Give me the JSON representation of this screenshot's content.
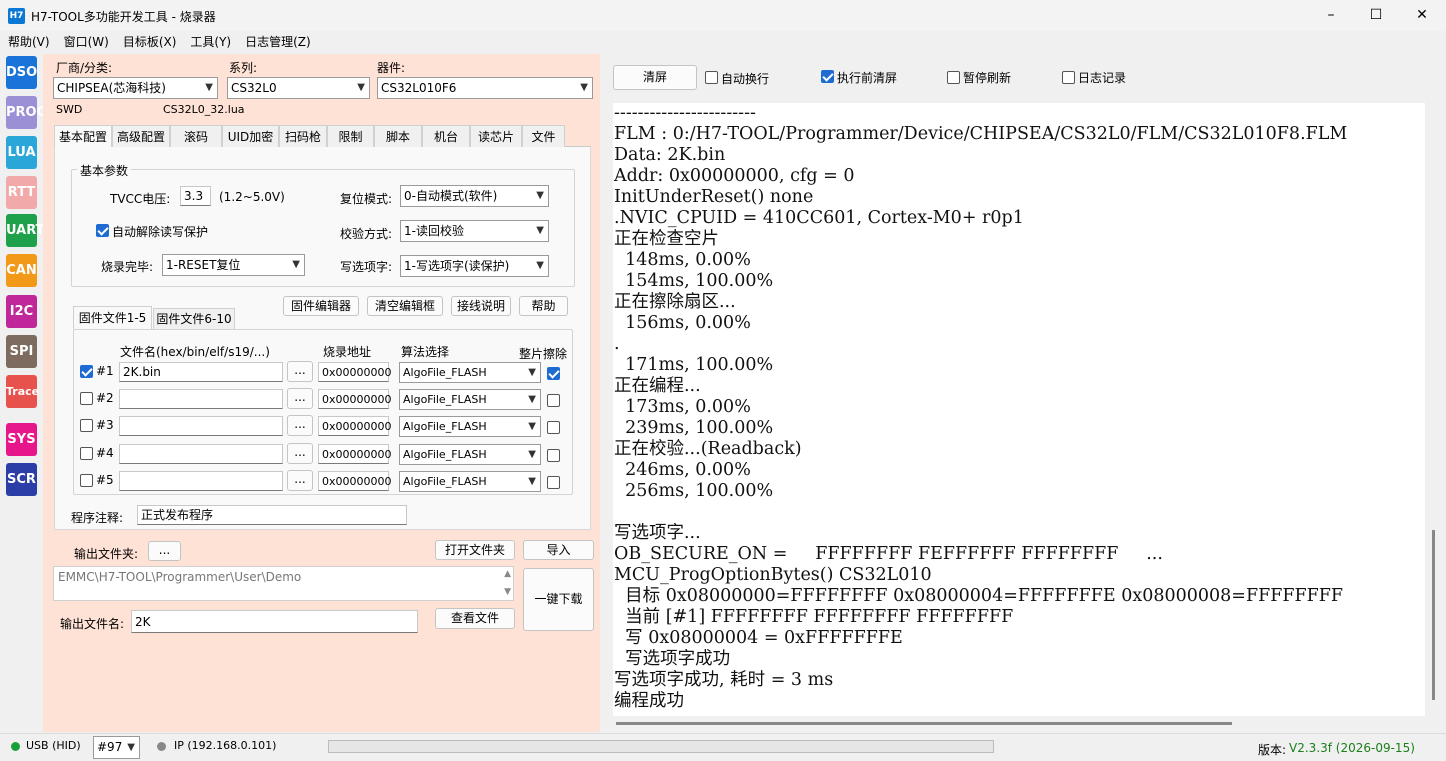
{
  "window": {
    "icon": "H7",
    "title": "H7-TOOL多功能开发工具 - 烧录器",
    "minimize_icon": "–",
    "maximize_icon": "☐",
    "close_icon": "✕"
  },
  "menu": [
    "帮助(V)",
    "窗口(W)",
    "目标板(X)",
    "工具(Y)",
    "日志管理(Z)"
  ],
  "sidebar": [
    {
      "label": "DSO",
      "color": "#1a73d9"
    },
    {
      "label": "PROG",
      "color": "#9b8fd6"
    },
    {
      "label": "LUA",
      "color": "#2aa6d8"
    },
    {
      "label": "RTT",
      "color": "#f2a9a9"
    },
    {
      "label": "UART",
      "color": "#1fa14b"
    },
    {
      "label": "CAN",
      "color": "#f29a18"
    },
    {
      "label": "I2C",
      "color": "#c0289a"
    },
    {
      "label": "SPI",
      "color": "#7d6b5f"
    },
    {
      "label": "Trace",
      "color": "#e8524c"
    },
    {
      "label": "SYS",
      "color": "#e6178a"
    },
    {
      "label": "SCR",
      "color": "#2b3ea8"
    }
  ],
  "device": {
    "vendor_label": "厂商/分类:",
    "vendor_value": "CHIPSEA(芯海科技)",
    "series_label": "系列:",
    "series_value": "CS32L0",
    "part_label": "器件:",
    "part_value": "CS32L010F6",
    "interface": "SWD",
    "lua_file": "CS32L0_32.lua"
  },
  "tabs": [
    "基本配置",
    "高级配置",
    "滚码",
    "UID加密",
    "扫码枪",
    "限制",
    "脚本",
    "机台",
    "读芯片",
    "文件"
  ],
  "basic": {
    "group_title": "基本参数",
    "tvcc_label": "TVCC电压:",
    "tvcc_value": "3.3",
    "tvcc_range": "(1.2~5.0V)",
    "auto_unprotect_label": "自动解除读写保护",
    "finish_label": "烧录完毕:",
    "finish_value": "1-RESET复位",
    "reset_label": "复位模式:",
    "reset_value": "0-自动模式(软件)",
    "verify_label": "校验方式:",
    "verify_value": "1-读回校验",
    "option_label": "写选项字:",
    "option_value": "1-写选项字(读保护)"
  },
  "fw": {
    "tab1": "固件文件1-5",
    "tab2": "固件文件6-10",
    "btn_editor": "固件编辑器",
    "btn_clear_editor": "清空编辑框",
    "btn_wiring": "接线说明",
    "btn_help": "帮助",
    "col_file": "文件名(hex/bin/elf/s19/...)",
    "col_addr": "烧录地址",
    "col_algo": "算法选择",
    "col_erase": "整片擦除",
    "browse": "...",
    "rows": [
      {
        "id": "#1",
        "checked": true,
        "file": "2K.bin",
        "addr": "0x00000000",
        "algo": "AlgoFile_FLASH",
        "erase": true
      },
      {
        "id": "#2",
        "checked": false,
        "file": "",
        "addr": "0x00000000",
        "algo": "AlgoFile_FLASH",
        "erase": false
      },
      {
        "id": "#3",
        "checked": false,
        "file": "",
        "addr": "0x00000000",
        "algo": "AlgoFile_FLASH",
        "erase": false
      },
      {
        "id": "#4",
        "checked": false,
        "file": "",
        "addr": "0x00000000",
        "algo": "AlgoFile_FLASH",
        "erase": false
      },
      {
        "id": "#5",
        "checked": false,
        "file": "",
        "addr": "0x00000000",
        "algo": "AlgoFile_FLASH",
        "erase": false
      }
    ],
    "note_label": "程序注释:",
    "note_value": "正式发布程序"
  },
  "output": {
    "folder_label": "输出文件夹:",
    "folder_browse": "...",
    "open_folder": "打开文件夹",
    "import": "导入",
    "path": "EMMC\\H7-TOOL\\Programmer\\User\\Demo",
    "filename_label": "输出文件名:",
    "filename_value": "2K",
    "view_file": "查看文件",
    "download": "一键下载"
  },
  "log_toolbar": {
    "clear": "清屏",
    "auto_wrap": "自动换行",
    "clear_before": "执行前清屏",
    "pause": "暂停刷新",
    "log_record": "日志记录"
  },
  "log_lines": [
    "------------------------",
    "FLM : 0:/H7-TOOL/Programmer/Device/CHIPSEA/CS32L0/FLM/CS32L010F8.FLM",
    "Data: 2K.bin",
    "Addr: 0x00000000, cfg = 0",
    "InitUnderReset() none",
    ".NVIC_CPUID = 410CC601, Cortex-M0+ r0p1",
    "正在检查空片",
    "  148ms, 0.00%",
    "  154ms, 100.00%",
    "正在擦除扇区...",
    "  156ms, 0.00%",
    ".",
    "  171ms, 100.00%",
    "正在编程...",
    "  173ms, 0.00%",
    "  239ms, 100.00%",
    "正在校验...(Readback)",
    "  246ms, 0.00%",
    "  256ms, 100.00%",
    "",
    "写选项字...",
    "OB_SECURE_ON =     FFFFFFFF FEFFFFFF FFFFFFFF     ...",
    "MCU_ProgOptionBytes() CS32L010",
    "  目标 0x08000000=FFFFFFFF 0x08000004=FFFFFFFE 0x08000008=FFFFFFFF",
    "  当前 [#1] FFFFFFFF FFFFFFFF FFFFFFFF",
    "  写 0x08000004 = 0xFFFFFFFE",
    "  写选项字成功",
    "写选项字成功, 耗时 = 3 ms",
    "编程成功"
  ],
  "status": {
    "usb": "USB (HID)",
    "device_no": "#97",
    "ip": "IP (192.168.0.101)",
    "version_label": "版本:",
    "version_value": "V2.3.3f (2026-09-15)"
  }
}
